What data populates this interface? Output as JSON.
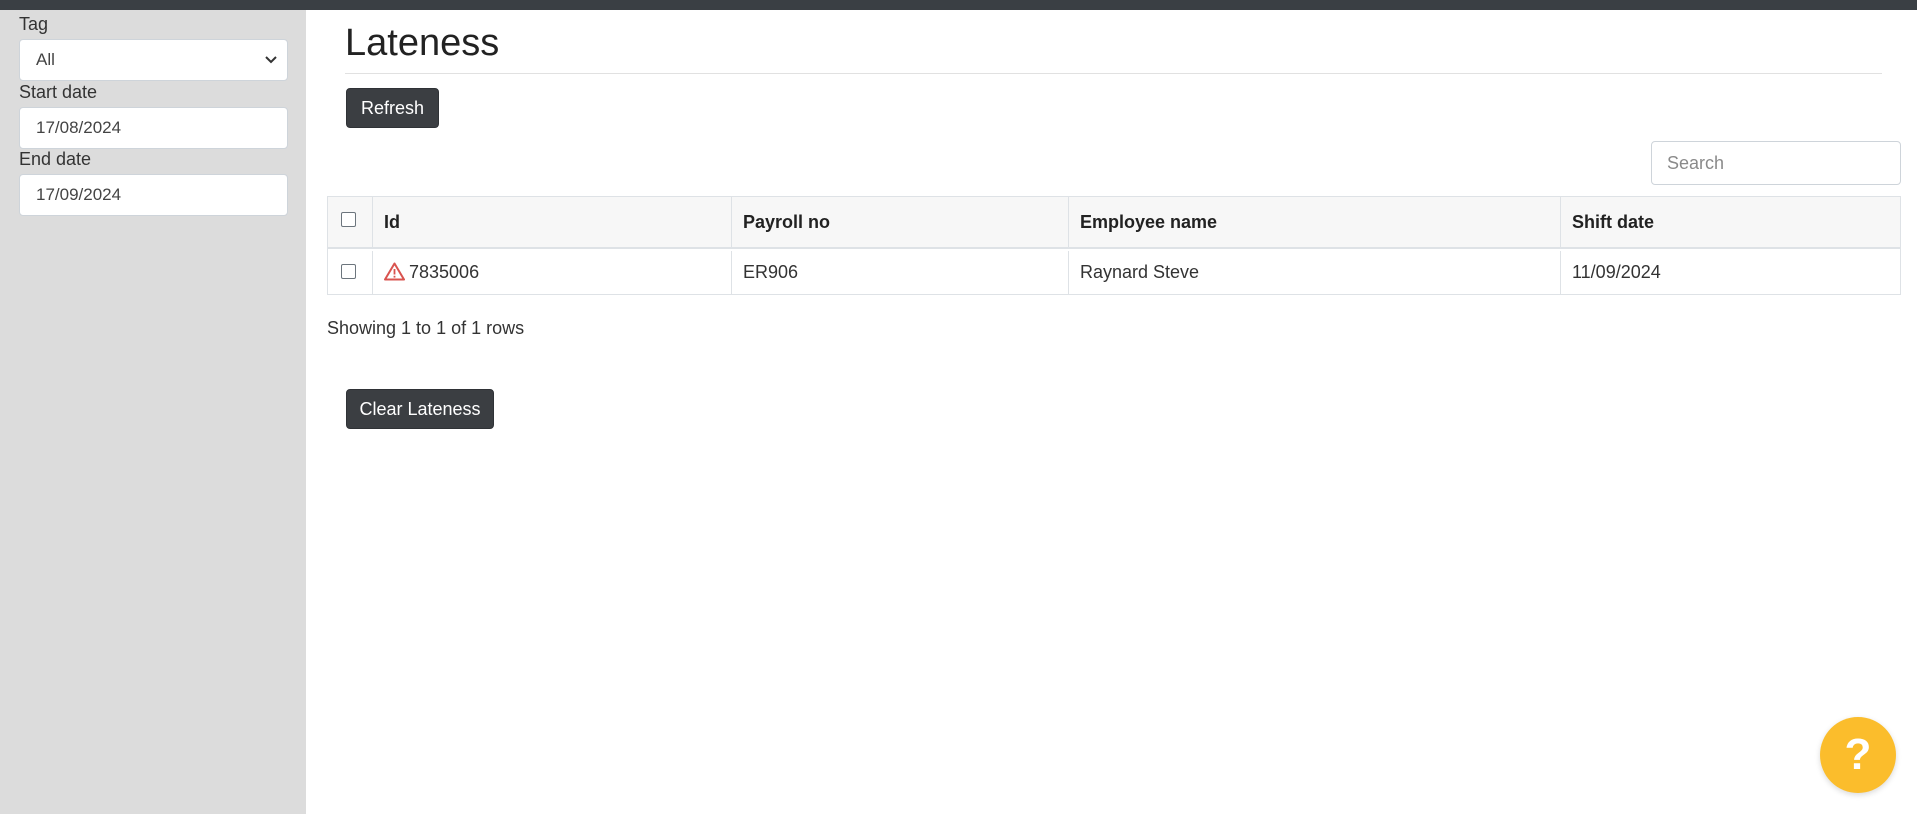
{
  "sidebar": {
    "tag_label": "Tag",
    "tag_value": "All",
    "start_date_label": "Start date",
    "start_date_value": "17/08/2024",
    "end_date_label": "End date",
    "end_date_value": "17/09/2024"
  },
  "main": {
    "title": "Lateness",
    "refresh_label": "Refresh",
    "search_placeholder": "Search",
    "table": {
      "headers": [
        "Id",
        "Payroll no",
        "Employee name",
        "Shift date"
      ],
      "rows": [
        {
          "id": "7835006",
          "payroll_no": "ER906",
          "employee_name": "Raynard Steve",
          "shift_date": "11/09/2024",
          "warning_icon": "warning-triangle-icon"
        }
      ]
    },
    "pagination_text": "Showing 1 to 1 of 1 rows",
    "clear_label": "Clear Lateness"
  },
  "help": {
    "label": "?"
  },
  "colors": {
    "sidebar_bg": "#dcdcdc",
    "button_dark": "#3b3e42",
    "help_accent": "#fbbd2c",
    "warning_red": "#d9534f"
  }
}
